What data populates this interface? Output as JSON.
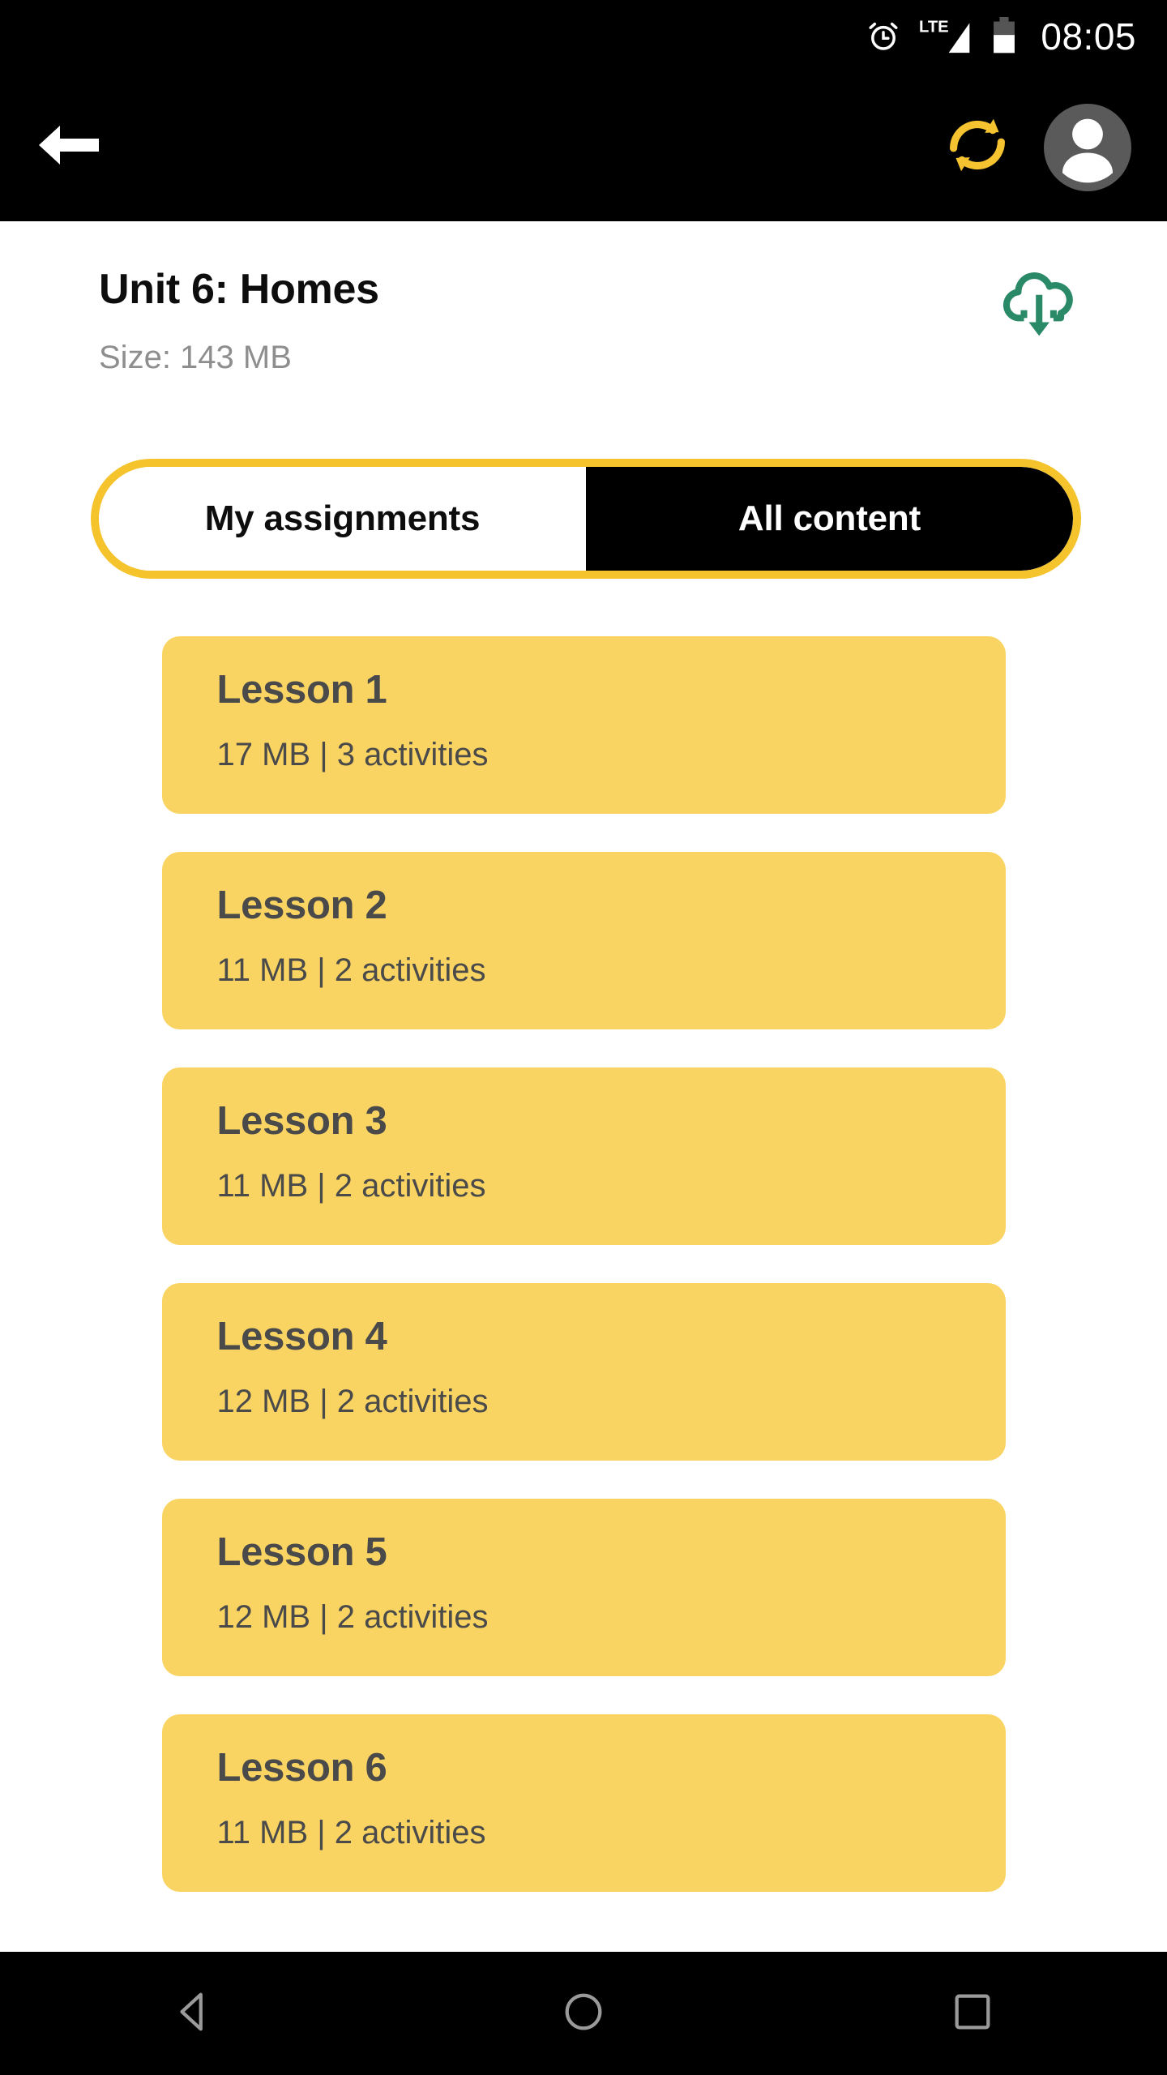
{
  "status_bar": {
    "time": "08:05",
    "network_label": "LTE",
    "icons": [
      "alarm-clock-icon",
      "lte-signal-icon",
      "battery-icon"
    ],
    "battery_level_percent": 50
  },
  "app_bar": {
    "back_icon": "back-arrow-icon",
    "sync_icon": "sync-refresh-icon",
    "avatar_icon": "user-avatar-icon",
    "sync_color": "#f5c330",
    "avatar_bg_color": "#5a5a5a",
    "background_color": "#000000"
  },
  "header": {
    "title": "Unit 6: Homes",
    "size_label": "Size: 143 MB",
    "download_icon": "cloud-download-icon",
    "download_icon_color": "#2a8a67"
  },
  "segmented_control": {
    "border_color": "#f5c32c",
    "active_index": 1,
    "options": [
      {
        "label": "My assignments",
        "active": false
      },
      {
        "label": "All content",
        "active": true
      }
    ]
  },
  "lessons": {
    "card_color": "#f9d462",
    "text_color": "#4a4a4a",
    "items": [
      {
        "title": "Lesson 1",
        "meta": "17 MB | 3 activities",
        "size": "17 MB",
        "activities": "3 activities"
      },
      {
        "title": "Lesson 2",
        "meta": "11 MB | 2 activities",
        "size": "11 MB",
        "activities": "2 activities"
      },
      {
        "title": "Lesson 3",
        "meta": "11 MB | 2 activities",
        "size": "11 MB",
        "activities": "2 activities"
      },
      {
        "title": "Lesson 4",
        "meta": "12 MB | 2 activities",
        "size": "12 MB",
        "activities": "2 activities"
      },
      {
        "title": "Lesson 5",
        "meta": "12 MB | 2 activities",
        "size": "12 MB",
        "activities": "2 activities"
      },
      {
        "title": "Lesson 6",
        "meta": "11 MB | 2 activities",
        "size": "11 MB",
        "activities": "2 activities"
      }
    ]
  },
  "nav_bar": {
    "background_color": "#000000",
    "icon_color": "#9a9a9a",
    "buttons": [
      {
        "name": "back-nav-icon"
      },
      {
        "name": "home-nav-icon"
      },
      {
        "name": "recents-nav-icon"
      }
    ]
  }
}
